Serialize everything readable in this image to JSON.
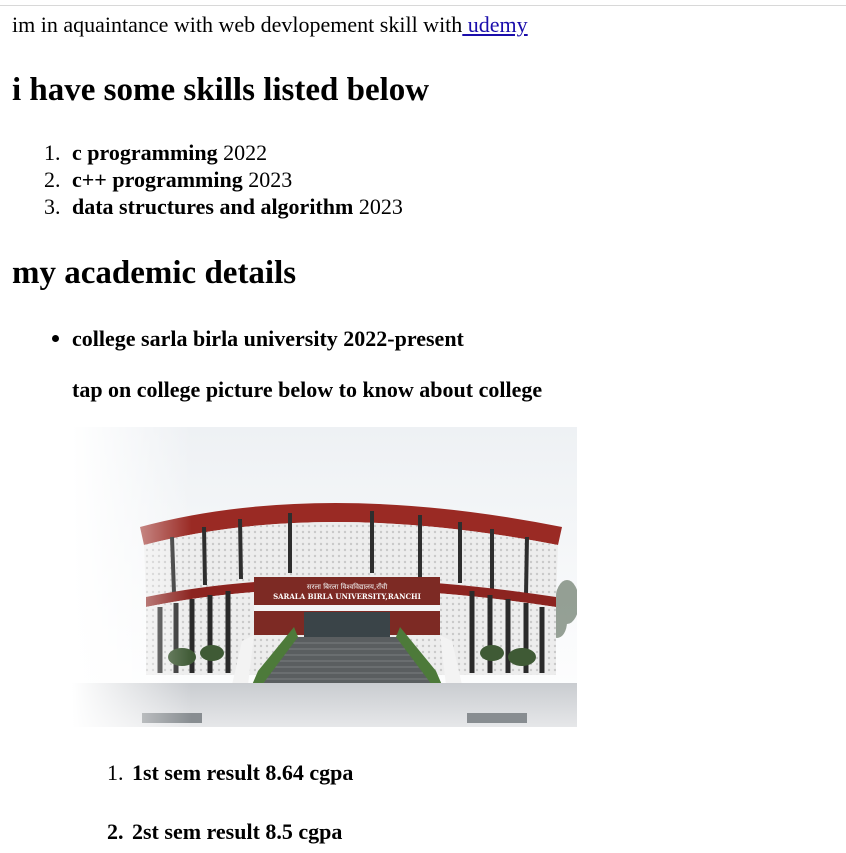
{
  "intro": {
    "text": "im in aquaintance with web devlopement skill with",
    "link_label": " udemy"
  },
  "skills_section": {
    "heading": "i have some skills listed below",
    "items": [
      {
        "number": "1.",
        "name": "c programming",
        "year": "2022"
      },
      {
        "number": "2.",
        "name": "c++ programming",
        "year": "2023"
      },
      {
        "number": "3.",
        "name": "data structures and algorithm",
        "year": "2023"
      }
    ]
  },
  "academic_section": {
    "heading": "my academic details",
    "college": "college sarla birla university 2022-present",
    "tap_note": "tap on college picture below to know about college",
    "building_sign_hindi": "सरला बिरला विश्वविद्यालय,राँची",
    "building_sign_english": "SARALA BIRLA UNIVERSITY,RANCHI",
    "results": [
      {
        "number": "1.",
        "text": "1st sem result 8.64 cgpa"
      },
      {
        "number": "2.",
        "text": "2st sem result 8.5 cgpa"
      }
    ]
  },
  "colors": {
    "link": "#1a0dab",
    "building_red": "#8c2420",
    "building_panel": "#e8e8e8"
  }
}
